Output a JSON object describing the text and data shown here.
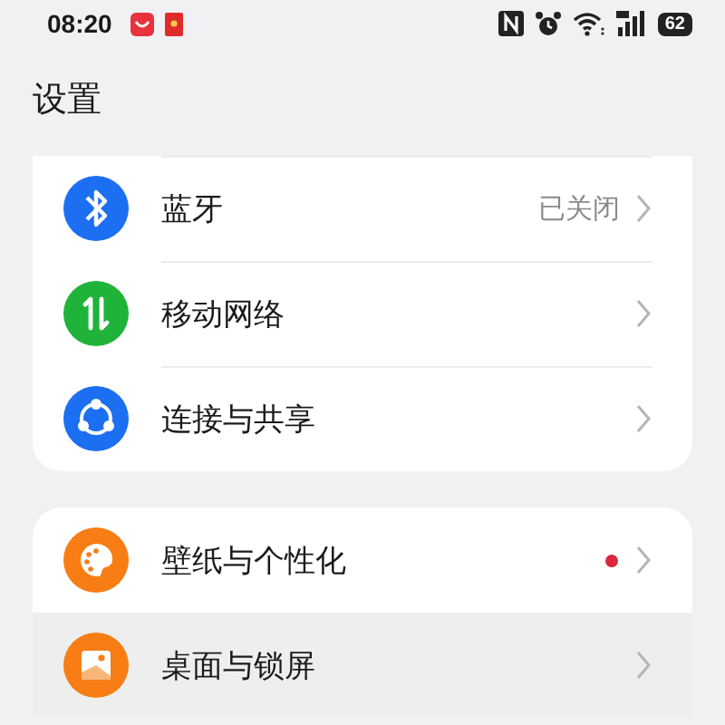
{
  "status_bar": {
    "time": "08:20",
    "battery": "62"
  },
  "header": {
    "title": "设置"
  },
  "groups": [
    {
      "items": [
        {
          "label": "蓝牙",
          "value": "已关闭",
          "badge": false,
          "selected": false
        },
        {
          "label": "移动网络",
          "badge": false,
          "selected": false
        },
        {
          "label": "连接与共享",
          "badge": false,
          "selected": false
        }
      ]
    },
    {
      "items": [
        {
          "label": "壁纸与个性化",
          "badge": true,
          "selected": false
        },
        {
          "label": "桌面与锁屏",
          "badge": false,
          "selected": true
        }
      ]
    }
  ]
}
